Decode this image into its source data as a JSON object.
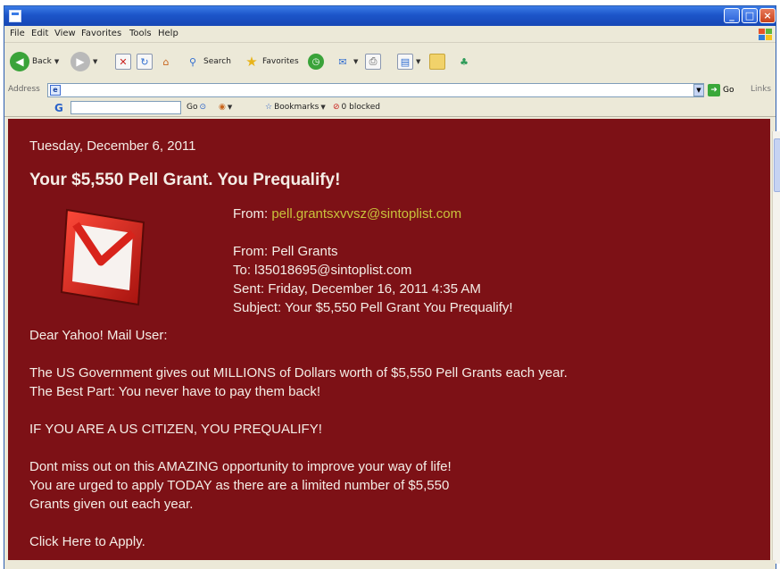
{
  "browser": {
    "title": "",
    "menu": [
      "File",
      "Edit",
      "View",
      "Favorites",
      "Tools",
      "Help"
    ],
    "toolbar": {
      "back": "Back",
      "search": "Search",
      "favorites": "Favorites"
    },
    "address": {
      "label": "Address",
      "value": "",
      "go": "Go",
      "links": "Links"
    },
    "google_bar": {
      "logo": "G",
      "go": "Go",
      "bookmarks": "Bookmarks",
      "blocked": "0 blocked"
    }
  },
  "email": {
    "date": "Tuesday, December 6, 2011",
    "title": "Your $5,550 Pell Grant. You Prequalify!",
    "from_label": "From:",
    "from_address": "pell.grantsxvvsz@sintoplist.com",
    "header": {
      "from": "From: Pell Grants",
      "to": "To: l35018695@sintoplist.com",
      "sent": "Sent: Friday, December 16, 2011 4:35 AM",
      "subject": "Subject: Your $5,550 Pell Grant You Prequalify!"
    },
    "greeting": "Dear Yahoo! Mail User:",
    "para1_line1": "The US Government gives out MILLIONS of Dollars worth of $5,550 Pell Grants each year.",
    "para1_line2": "The Best Part: You never have to pay them back!",
    "para2": "IF YOU ARE A US CITIZEN, YOU PREQUALIFY!",
    "para3_line1": "Dont miss out on this AMAZING opportunity to improve your way of life!",
    "para3_line2": "You are urged to apply TODAY as there are a limited number of $5,550",
    "para3_line3": "Grants given out each year.",
    "cta": "Click Here to Apply."
  },
  "icons": [
    "ie-app-icon",
    "minimize-icon",
    "maximize-icon",
    "close-icon",
    "windows-flag-icon",
    "back-arrow-icon",
    "forward-arrow-icon",
    "stop-icon",
    "refresh-icon",
    "home-icon",
    "search-icon",
    "favorites-star-icon",
    "history-icon",
    "mail-icon",
    "print-icon",
    "edit-icon",
    "folder-icon",
    "messenger-icon",
    "page-icon",
    "go-arrow-icon",
    "envelope-icon"
  ],
  "colors": {
    "email_background": "#7d1116",
    "email_text": "#f4ede6",
    "link": "#c9c23b",
    "titlebar": "#1c55c9"
  }
}
